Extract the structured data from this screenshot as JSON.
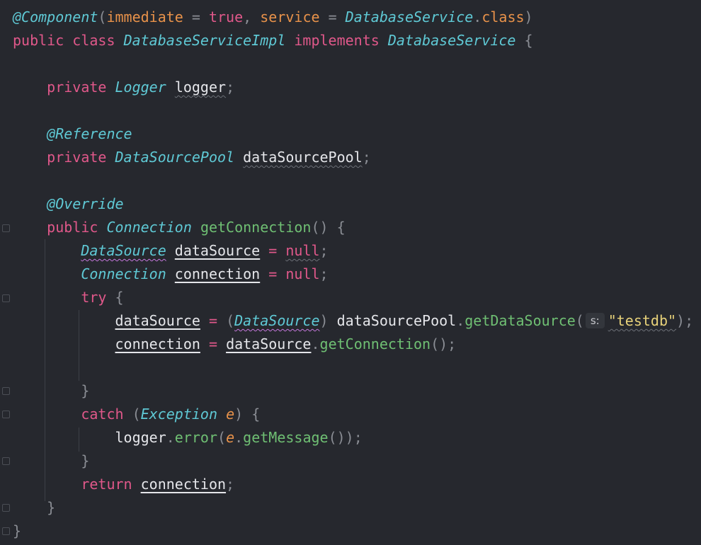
{
  "editor": {
    "lines": {
      "l1": {
        "annotation": "@Component",
        "open_paren": "(",
        "attr1": "immediate",
        "eq1": " = ",
        "val1": "true",
        "comma": ", ",
        "attr2": "service",
        "eq2": " = ",
        "type": "DatabaseService",
        "dot": ".",
        "cls": "class",
        "close_paren": ")"
      },
      "l2": {
        "kw_public": "public",
        "kw_class": "class",
        "class_name": "DatabaseServiceImpl",
        "kw_implements": "implements",
        "iface": "DatabaseService",
        "brace": "{"
      },
      "l4": {
        "kw": "private",
        "type": "Logger",
        "name": "logger",
        "semi": ";"
      },
      "l6": {
        "annotation": "@Reference"
      },
      "l7": {
        "kw": "private",
        "type": "DataSourcePool",
        "name": "dataSourcePool",
        "semi": ";"
      },
      "l9": {
        "annotation": "@Override"
      },
      "l10": {
        "kw": "public",
        "type": "Connection",
        "method": "getConnection",
        "parens": "()",
        "brace": "{"
      },
      "l11": {
        "type": "DataSource",
        "name": "dataSource",
        "eq": "=",
        "val": "null",
        "semi": ";"
      },
      "l12": {
        "type": "Connection",
        "name": "connection",
        "eq": "=",
        "val": "null",
        "semi": ";"
      },
      "l13": {
        "kw": "try",
        "brace": "{"
      },
      "l14": {
        "name": "dataSource",
        "eq": "=",
        "cast_open": "(",
        "cast_type": "DataSource",
        "cast_close": ")",
        "obj": "dataSourcePool",
        "dot": ".",
        "method": "getDataSource",
        "open": "(",
        "hint": "s:",
        "arg": "\"testdb\"",
        "close": ");"
      },
      "l15": {
        "name": "connection",
        "eq": "=",
        "obj": "dataSource",
        "dot": ".",
        "method": "getConnection",
        "close": "();"
      },
      "l17": {
        "brace": "}"
      },
      "l18": {
        "kw": "catch",
        "open": "(",
        "type": "Exception",
        "param": "e",
        "close": ")",
        "brace": "{"
      },
      "l19": {
        "obj": "logger",
        "dot1": ".",
        "method1": "error",
        "open": "(",
        "param": "e",
        "dot2": ".",
        "method2": "getMessage",
        "close": "());"
      },
      "l20": {
        "brace": "}"
      },
      "l21": {
        "kw": "return",
        "name": "connection",
        "semi": ";"
      },
      "l22": {
        "brace": "}"
      },
      "l23": {
        "brace": "}"
      }
    }
  }
}
